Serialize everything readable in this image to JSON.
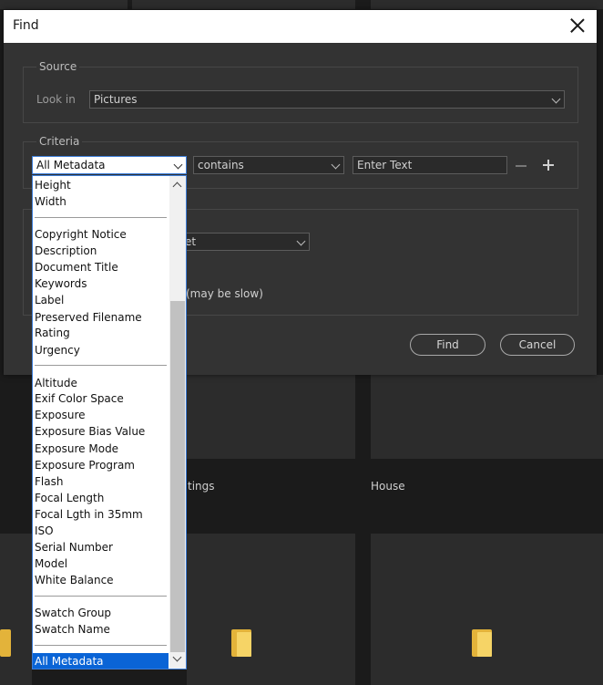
{
  "dialog": {
    "title": "Find",
    "source": {
      "group_label": "Source",
      "look_in_label": "Look in",
      "look_in_value": "Pictures"
    },
    "criteria": {
      "group_label": "Criteria",
      "field_value": "All Metadata",
      "operator_value": "contains",
      "text_placeholder": "Enter Text"
    },
    "results": {
      "match_value_partial": "et",
      "option_partial": "(may be slow)"
    },
    "buttons": {
      "find": "Find",
      "cancel": "Cancel"
    }
  },
  "dropdown": {
    "groups": [
      [
        "Height",
        "Width"
      ],
      [
        "Copyright Notice",
        "Description",
        "Document Title",
        "Keywords",
        "Label",
        "Preserved Filename",
        "Rating",
        "Urgency"
      ],
      [
        "Altitude",
        "Exif Color Space",
        "Exposure",
        "Exposure Bias Value",
        "Exposure Mode",
        "Exposure Program",
        "Flash",
        "Focal Length",
        "Focal Lgth in 35mm",
        "ISO",
        "Serial Number",
        "Model",
        "White Balance"
      ],
      [
        "Swatch Group",
        "Swatch Name"
      ]
    ],
    "selected": "All Metadata"
  },
  "background": {
    "tile_labels": [
      "tings",
      "House"
    ]
  },
  "colors": {
    "dialog_bg": "#333333",
    "selection": "#0a64d6",
    "folder": "#f6d466"
  }
}
